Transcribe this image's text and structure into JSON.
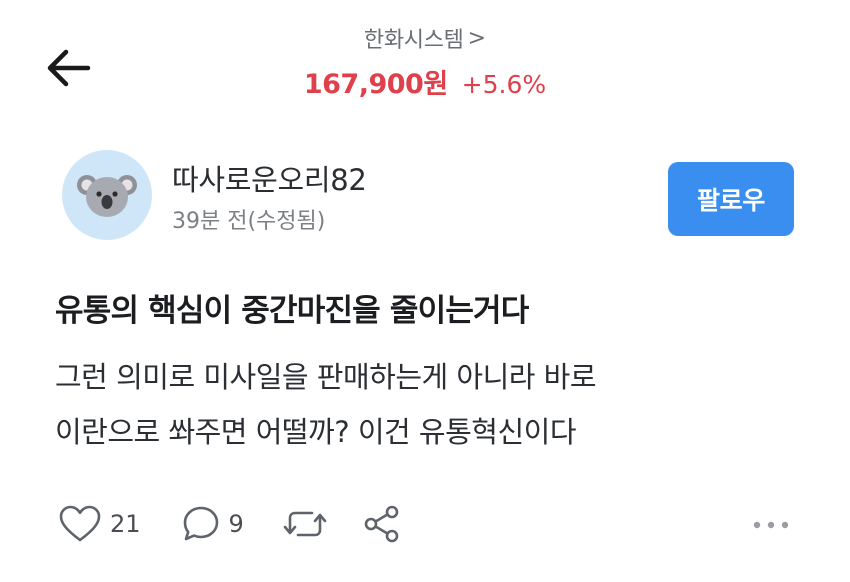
{
  "header": {
    "stock_name": "한화시스템",
    "chevron": ">",
    "price": "167,900원",
    "change": "+5.6%",
    "accent_color": "#e0404b"
  },
  "author": {
    "name": "따사로운오리82",
    "time": "39분 전(수정됨)",
    "avatar_icon": "koala-icon"
  },
  "follow_button": {
    "label": "팔로우",
    "color": "#3a8eef"
  },
  "post": {
    "title": "유통의 핵심이 중간마진을 줄이는거다",
    "body_lines": [
      "그런 의미로 미사일을 판매하는게 아니라 바로",
      "이란으로 쏴주면 어떨까? 이건 유통혁신이다"
    ]
  },
  "actions": {
    "likes": "21",
    "comments": "9",
    "icons": [
      "heart-icon",
      "comment-icon",
      "repost-icon",
      "share-icon",
      "more-icon"
    ]
  }
}
